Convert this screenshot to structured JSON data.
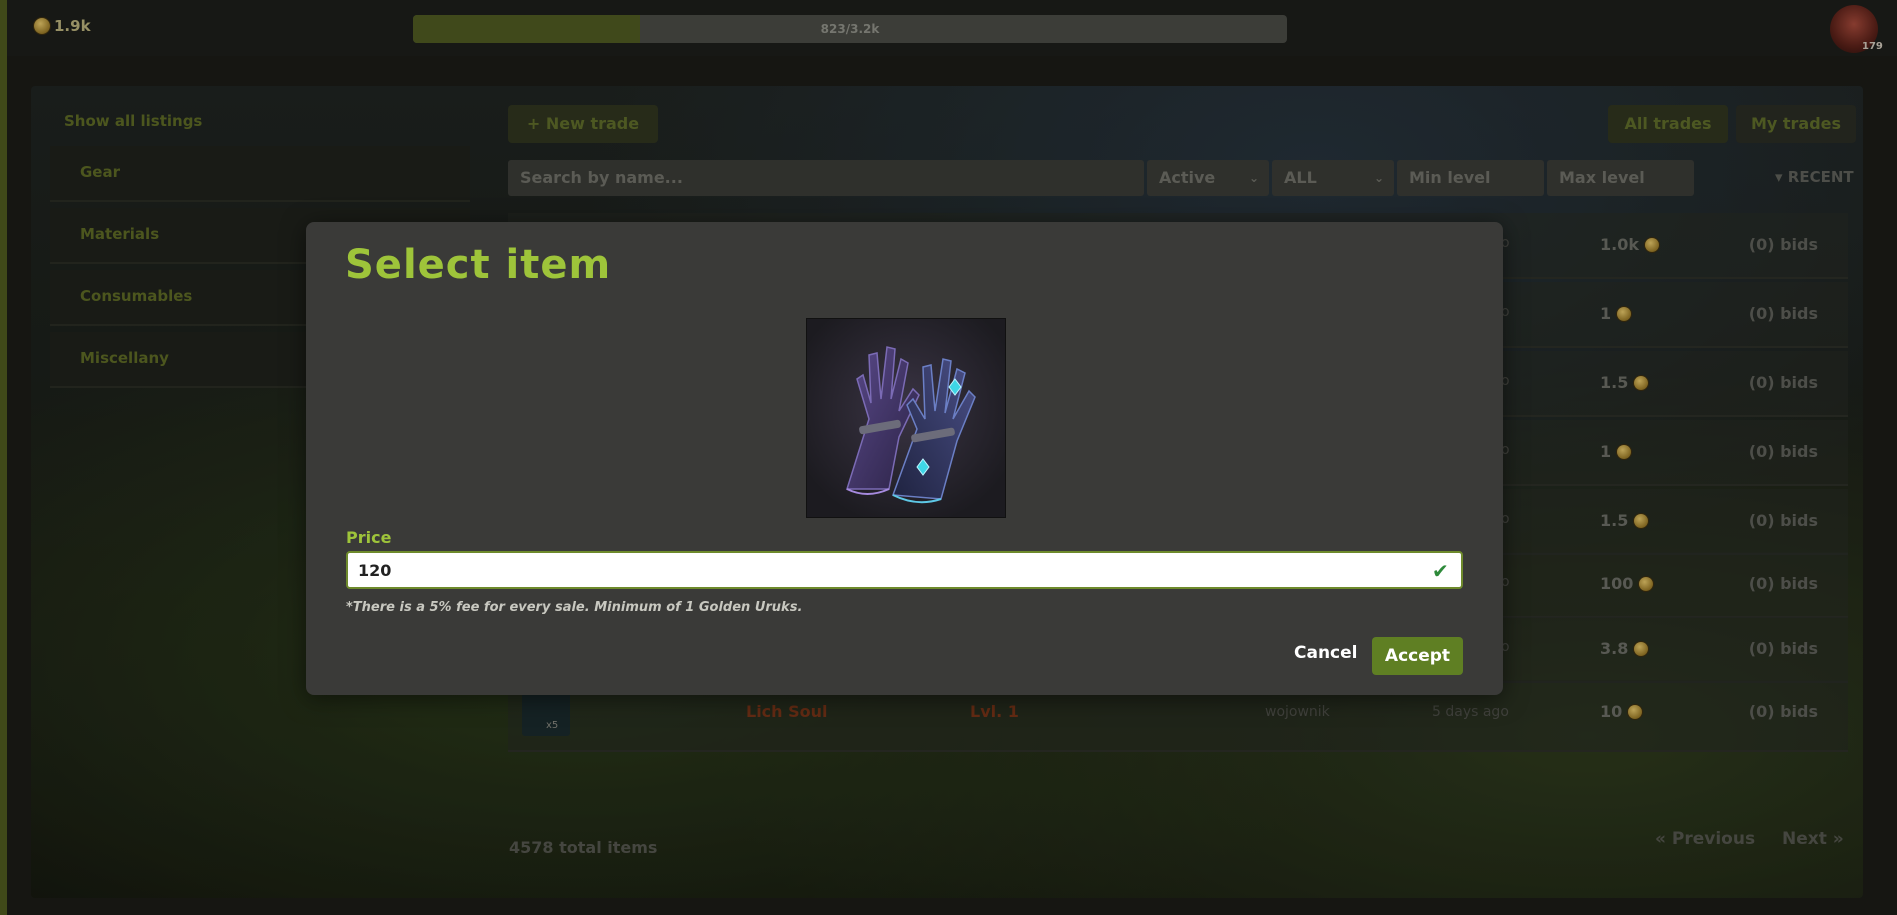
{
  "topbar": {
    "gold": "1.9k",
    "xp_text": "823/3.2k",
    "xp_fraction": 0.26,
    "avatar_level": "179"
  },
  "sidebar": {
    "show_all": "Show all listings",
    "items": [
      {
        "label": "Gear"
      },
      {
        "label": "Materials"
      },
      {
        "label": "Consumables"
      },
      {
        "label": "Miscellany"
      }
    ]
  },
  "toolbar": {
    "new_trade": "+ New trade",
    "all_trades": "All trades",
    "my_trades": "My trades",
    "search_placeholder": "Search by name...",
    "status_select": "Active",
    "type_select": "ALL",
    "min_level_placeholder": "Min level",
    "max_level_placeholder": "Max level",
    "sort": "RECENT"
  },
  "listings": [
    {
      "ago_tail": "o",
      "price": "1.0k",
      "bids": "(0) bids"
    },
    {
      "ago_tail": "o",
      "price": "1",
      "bids": "(0) bids"
    },
    {
      "ago_tail": "o",
      "price": "1.5",
      "bids": "(0) bids"
    },
    {
      "ago_tail": "o",
      "price": "1",
      "bids": "(0) bids"
    },
    {
      "ago_tail": "o",
      "price": "1.5",
      "bids": "(0) bids"
    },
    {
      "ago_tail": "o",
      "price": "100",
      "bids": "(0) bids"
    },
    {
      "ago_tail": "o",
      "price": "3.8",
      "bids": "(0) bids"
    },
    {
      "name": "Lich Soul",
      "level": "Lvl. 1",
      "seller": "wojownik",
      "when": "5 days ago",
      "qty": "x5",
      "price": "10",
      "bids": "(0) bids"
    }
  ],
  "footer": {
    "total": "4578 total items",
    "previous": "« Previous",
    "next": "Next »"
  },
  "modal": {
    "title": "Select item",
    "item_icon": "glowing-gloves-icon",
    "price_label": "Price",
    "price_value": "120",
    "fee_note": "*There is a 5% fee for every sale. Minimum of 1 Golden Uruks.",
    "cancel": "Cancel",
    "accept": "Accept"
  },
  "colors": {
    "accent": "#9ec43a",
    "accept_button": "#5f7f23",
    "modal_bg": "#3a3a38"
  }
}
